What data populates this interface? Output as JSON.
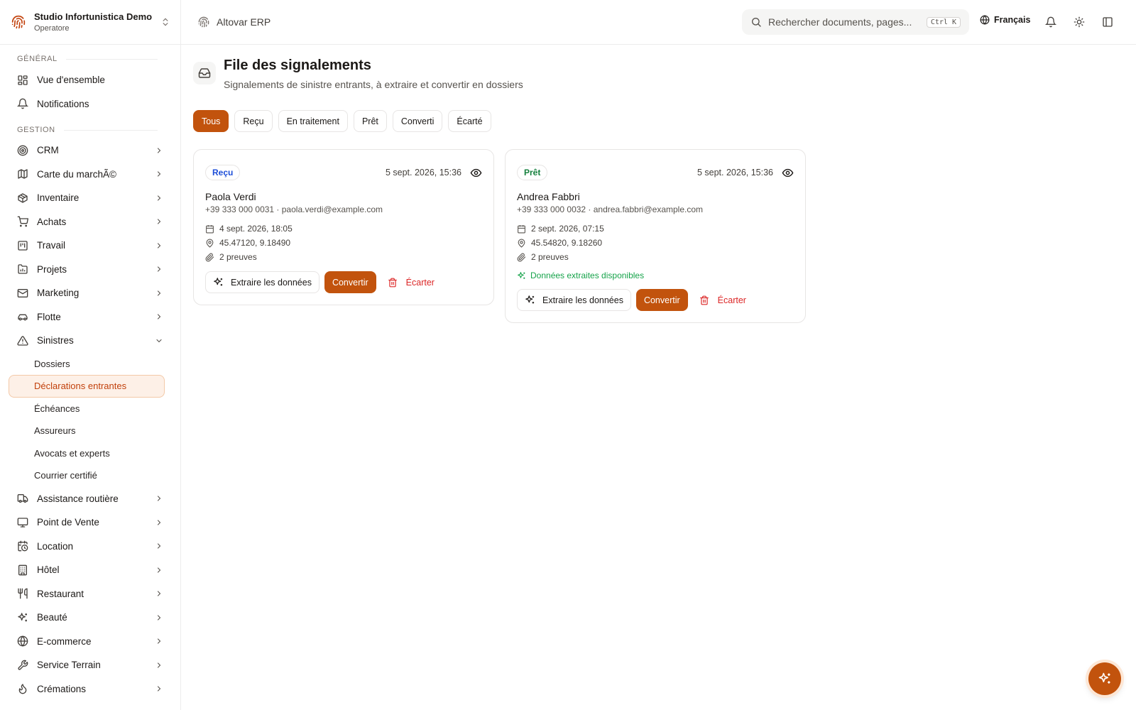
{
  "org": {
    "name": "Studio Infortunistica Demo",
    "role": "Operatore"
  },
  "sidebar": {
    "section_general": "GÉNÉRAL",
    "general_items": [
      {
        "label": "Vue d'ensemble",
        "icon": "grid-icon"
      },
      {
        "label": "Notifications",
        "icon": "bell-icon"
      }
    ],
    "section_management": "GESTION",
    "items": [
      {
        "label": "CRM",
        "icon": "target-icon"
      },
      {
        "label": "Carte du marchÃ©",
        "icon": "map-icon"
      },
      {
        "label": "Inventaire",
        "icon": "box-icon"
      },
      {
        "label": "Achats",
        "icon": "cart-icon"
      },
      {
        "label": "Travail",
        "icon": "kanban-icon"
      },
      {
        "label": "Projets",
        "icon": "projects-icon"
      },
      {
        "label": "Marketing",
        "icon": "mail-icon"
      },
      {
        "label": "Flotte",
        "icon": "car-icon"
      },
      {
        "label": "Sinistres",
        "icon": "warning-icon"
      }
    ],
    "sub_items": [
      {
        "label": "Dossiers"
      },
      {
        "label": "Déclarations entrantes"
      },
      {
        "label": "Échéances"
      },
      {
        "label": "Assureurs"
      },
      {
        "label": "Avocats et experts"
      },
      {
        "label": "Courrier certifié"
      }
    ],
    "items_after": [
      {
        "label": "Assistance routière",
        "icon": "truck-icon"
      },
      {
        "label": "Point de Vente",
        "icon": "monitor-icon"
      },
      {
        "label": "Location",
        "icon": "calendar-clock-icon"
      },
      {
        "label": "Hôtel",
        "icon": "building-icon"
      },
      {
        "label": "Restaurant",
        "icon": "utensils-icon"
      },
      {
        "label": "Beauté",
        "icon": "sparkles-icon"
      },
      {
        "label": "E-commerce",
        "icon": "globe-icon"
      },
      {
        "label": "Service Terrain",
        "icon": "wrench-icon"
      },
      {
        "label": "Crémations",
        "icon": "flame-icon"
      }
    ]
  },
  "topbar": {
    "app_name": "Altovar ERP",
    "search_placeholder": "Rechercher documents, pages...",
    "search_shortcut": "Ctrl K",
    "language": "Français"
  },
  "page": {
    "title": "File des signalements",
    "subtitle": "Signalements de sinistre entrants, à extraire et convertir en dossiers"
  },
  "filters": [
    "Tous",
    "Reçu",
    "En traitement",
    "Prêt",
    "Converti",
    "Écarté"
  ],
  "active_filter": "Tous",
  "cards": [
    {
      "status": "Reçu",
      "received_at": "5 sept. 2026, 15:36",
      "name": "Paola Verdi",
      "contact": "+39 333 000 0031 · paola.verdi@example.com",
      "incident_date": "4 sept. 2026, 18:05",
      "coordinates": "45.47120, 9.18490",
      "evidence": "2 preuves",
      "extract_label": "Extraire les données",
      "convert_label": "Convertir",
      "discard_label": "Écarter"
    },
    {
      "status": "Prêt",
      "received_at": "5 sept. 2026, 15:36",
      "name": "Andrea Fabbri",
      "contact": "+39 333 000 0032 · andrea.fabbri@example.com",
      "incident_date": "2 sept. 2026, 07:15",
      "coordinates": "45.54820, 9.18260",
      "evidence": "2 preuves",
      "extracted_note": "Données extraites disponibles",
      "extract_label": "Extraire les données",
      "convert_label": "Convertir",
      "discard_label": "Écarter"
    }
  ],
  "colors": {
    "accent": "#c2530d",
    "accent_soft": "#fdf0e7",
    "received": "#1d4ed8",
    "ready": "#15803d",
    "danger": "#dc2626"
  }
}
